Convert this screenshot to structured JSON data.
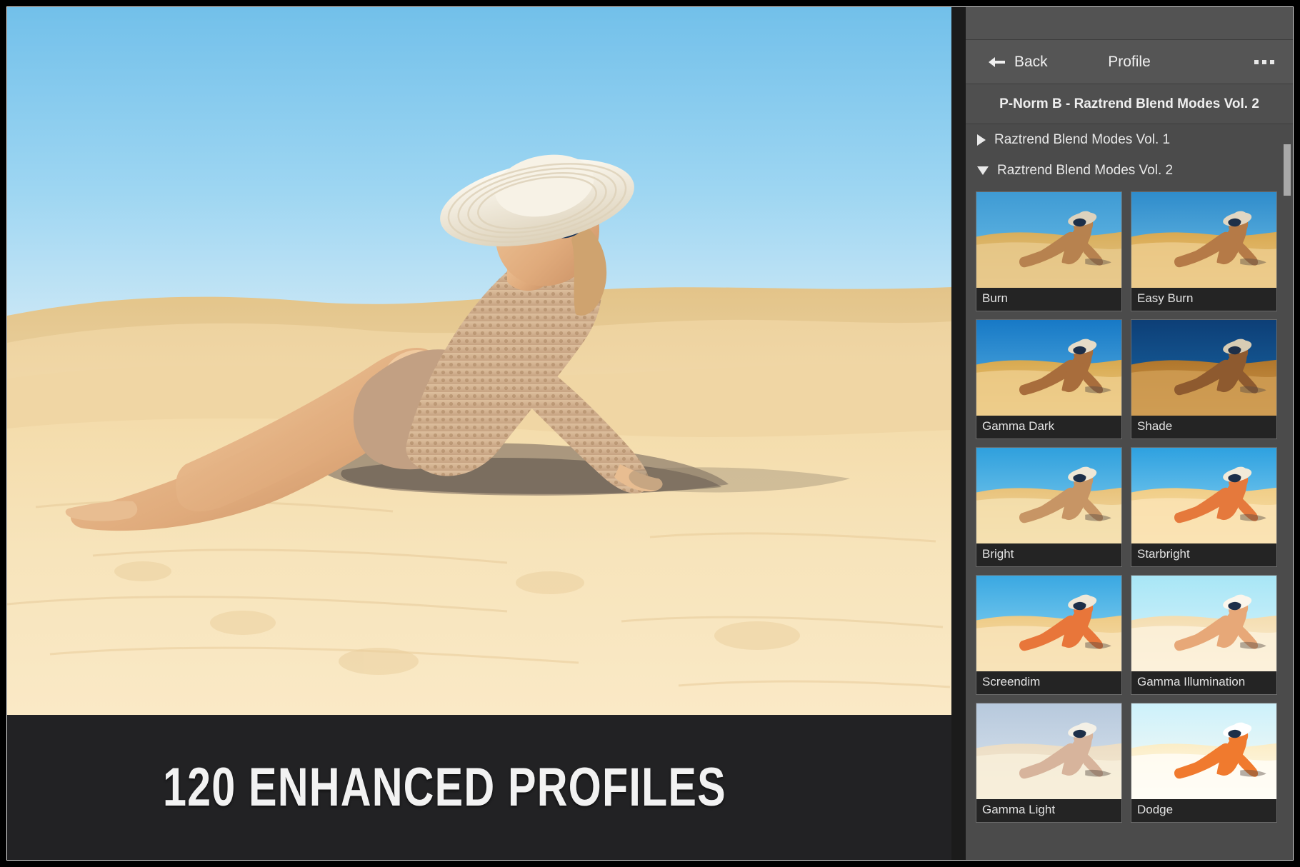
{
  "banner": {
    "text": "120 ENHANCED PROFILES"
  },
  "panel": {
    "header": {
      "back_label": "Back",
      "title": "Profile",
      "back_icon": "arrow-left-icon",
      "menu_icon": "ellipsis-icon"
    },
    "preset_name": "P-Norm B - Raztrend Blend Modes Vol. 2",
    "groups": [
      {
        "label": "Raztrend Blend Modes Vol. 1",
        "expanded": false,
        "icon": "triangle-right-icon"
      },
      {
        "label": "Raztrend Blend Modes Vol. 2",
        "expanded": true,
        "icon": "triangle-down-icon"
      }
    ],
    "thumbnails": [
      {
        "label": "Burn",
        "sky_top": "#3f9bd4",
        "sky_bottom": "#6fc0e8",
        "sand_top": "#d8ae5c",
        "sand_bottom": "#e8c98c",
        "skin": "#b7824f",
        "hat": "#ddd2bd"
      },
      {
        "label": "Easy Burn",
        "sky_top": "#2f8ccb",
        "sky_bottom": "#74c3e9",
        "sand_top": "#d9a951",
        "sand_bottom": "#eccb8c",
        "skin": "#b57a47",
        "hat": "#e2d7c3"
      },
      {
        "label": "Gamma Dark",
        "sky_top": "#1779c6",
        "sky_bottom": "#5fb6e4",
        "sand_top": "#d8a94f",
        "sand_bottom": "#edcd8b",
        "skin": "#a86d3c",
        "hat": "#e6dcc8"
      },
      {
        "label": "Shade",
        "sky_top": "#0d3f77",
        "sky_bottom": "#1b6aa8",
        "sand_top": "#b0762b",
        "sand_bottom": "#cf9c53",
        "skin": "#8e5a2f",
        "hat": "#d8ccb4"
      },
      {
        "label": "Bright",
        "sky_top": "#2fa0dd",
        "sky_bottom": "#8fd3f0",
        "sand_top": "#e8c27a",
        "sand_bottom": "#f5e0b0",
        "skin": "#c79565",
        "hat": "#efe7d6"
      },
      {
        "label": "Starbright",
        "sky_top": "#2ea1e0",
        "sky_bottom": "#96d8f3",
        "sand_top": "#f0cd86",
        "sand_bottom": "#fae3b4",
        "skin": "#e5793c",
        "hat": "#f2ead9"
      },
      {
        "label": "Screendim",
        "sky_top": "#3aa8e2",
        "sky_bottom": "#9adcf4",
        "sand_top": "#eecb86",
        "sand_bottom": "#f8e3b8",
        "skin": "#e8763a",
        "hat": "#f0e8d8"
      },
      {
        "label": "Gamma Illumination",
        "sky_top": "#a8e6f6",
        "sky_bottom": "#ddf4fb",
        "sand_top": "#f4ddb0",
        "sand_bottom": "#fcf1da",
        "skin": "#e7a878",
        "hat": "#fbf6ec"
      },
      {
        "label": "Gamma Light",
        "sky_top": "#b7c9dd",
        "sky_bottom": "#dde6ee",
        "sand_top": "#ecddc4",
        "sand_bottom": "#f7eeda",
        "skin": "#d7b49c",
        "hat": "#f4f0e6"
      },
      {
        "label": "Dodge",
        "sky_top": "#cdf1fb",
        "sky_bottom": "#fdfbf3",
        "sand_top": "#fbedc6",
        "sand_bottom": "#fffdf6",
        "skin": "#f07a2e",
        "hat": "#ffffff"
      }
    ]
  },
  "colors": {
    "panel_bg": "#4b4b4b",
    "header_bg": "#555555",
    "banner_bg": "#222224",
    "frame": "#000000",
    "text": "#f0f0f0",
    "scrollbar": "#a9a9a9"
  }
}
